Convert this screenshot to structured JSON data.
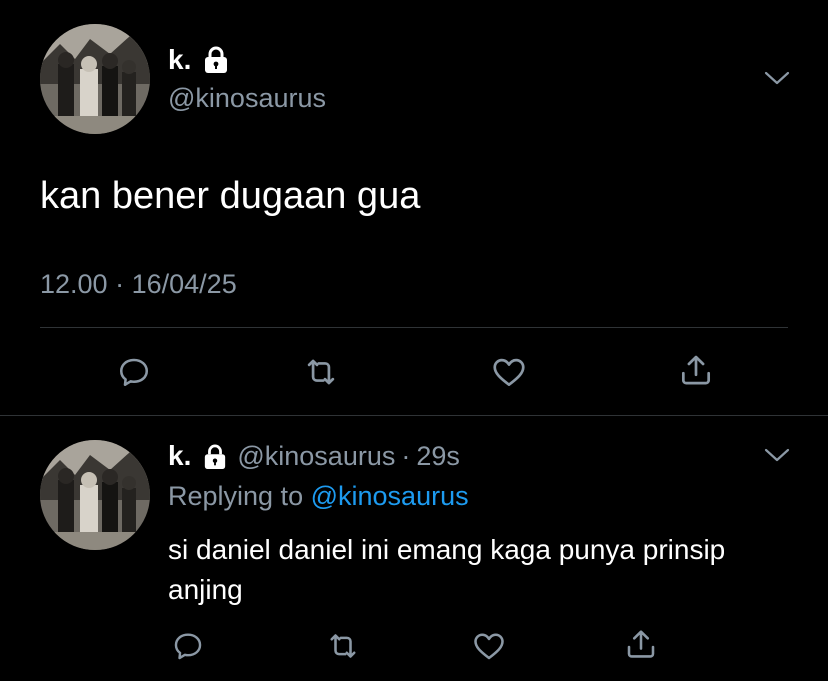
{
  "tweet": {
    "display_name": "k.",
    "handle": "@kinosaurus",
    "text": "kan bener dugaan gua",
    "time": "12.00",
    "separator": "·",
    "date": "16/04/25"
  },
  "reply": {
    "display_name": "k.",
    "handle": "@kinosaurus",
    "separator": "·",
    "time_ago": "29s",
    "replying_prefix": "Replying to",
    "replying_handle": "@kinosaurus",
    "text": "si daniel daniel ini emang kaga punya prinsip anjing"
  },
  "icons": {
    "lock": "lock-icon",
    "caret": "chevron-down-icon",
    "reply": "reply-icon",
    "retweet": "retweet-icon",
    "like": "heart-icon",
    "share": "share-icon"
  },
  "colors": {
    "background": "#000000",
    "text_primary": "#ffffff",
    "text_secondary": "#8b98a5",
    "link": "#1d9bf0",
    "divider": "#2f3336"
  }
}
